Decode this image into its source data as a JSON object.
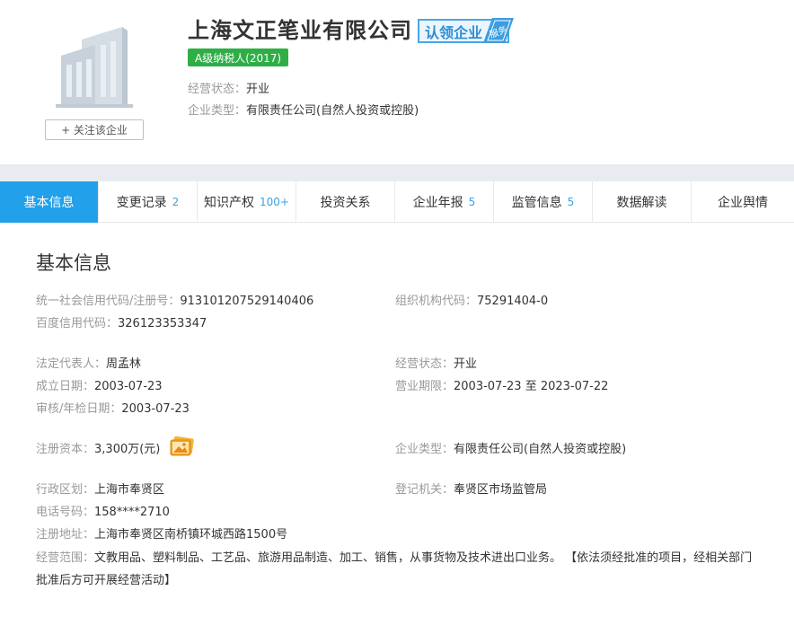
{
  "header": {
    "company_name": "上海文正笔业有限公司",
    "claim_badge": "认领企业",
    "claim_tag": "服务",
    "tax_badge": "A级纳税人(2017)",
    "status_key": "经营状态：",
    "status_val": "开业",
    "type_key": "企业类型：",
    "type_val": "有限责任公司(自然人投资或控股)",
    "follow_button": "+ 关注该企业"
  },
  "tabs": [
    {
      "label": "基本信息",
      "count": ""
    },
    {
      "label": "变更记录",
      "count": "2"
    },
    {
      "label": "知识产权",
      "count": "100+"
    },
    {
      "label": "投资关系",
      "count": ""
    },
    {
      "label": "企业年报",
      "count": "5"
    },
    {
      "label": "监管信息",
      "count": "5"
    },
    {
      "label": "数据解读",
      "count": ""
    },
    {
      "label": "企业舆情",
      "count": ""
    }
  ],
  "basic": {
    "title": "基本信息",
    "credit_code_key": "统一社会信用代码/注册号：",
    "credit_code_val": "913101207529140406",
    "org_code_key": "组织机构代码：",
    "org_code_val": "75291404-0",
    "baidu_code_key": "百度信用代码：",
    "baidu_code_val": "326123353347",
    "legal_rep_key": "法定代表人：",
    "legal_rep_val": "周孟林",
    "op_status_key": "经营状态：",
    "op_status_val": "开业",
    "est_date_key": "成立日期：",
    "est_date_val": "2003-07-23",
    "term_key": "营业期限：",
    "term_val": "2003-07-23 至 2023-07-22",
    "review_key": "审核/年检日期：",
    "review_val": "2003-07-23",
    "capital_key": "注册资本：",
    "capital_val": "3,300万(元)",
    "ent_type_key": "企业类型：",
    "ent_type_val": "有限责任公司(自然人投资或控股)",
    "region_key": "行政区划：",
    "region_val": "上海市奉贤区",
    "authority_key": "登记机关：",
    "authority_val": "奉贤区市场监管局",
    "phone_key": "电话号码：",
    "phone_val": "158****2710",
    "address_key": "注册地址：",
    "address_val": "上海市奉贤区南桥镇环城西路1500号",
    "scope_key": "经营范围：",
    "scope_val": "文教用品、塑料制品、工艺品、旅游用品制造、加工、销售，从事货物及技术进出口业务。 【依法须经批准的项目，经相关部门批准后方可开展经营活动】"
  },
  "colors": {
    "accent": "#22a0e9",
    "tax_badge": "#2fae46",
    "claim_border": "#4aa6e6",
    "label_gray": "#999999"
  }
}
